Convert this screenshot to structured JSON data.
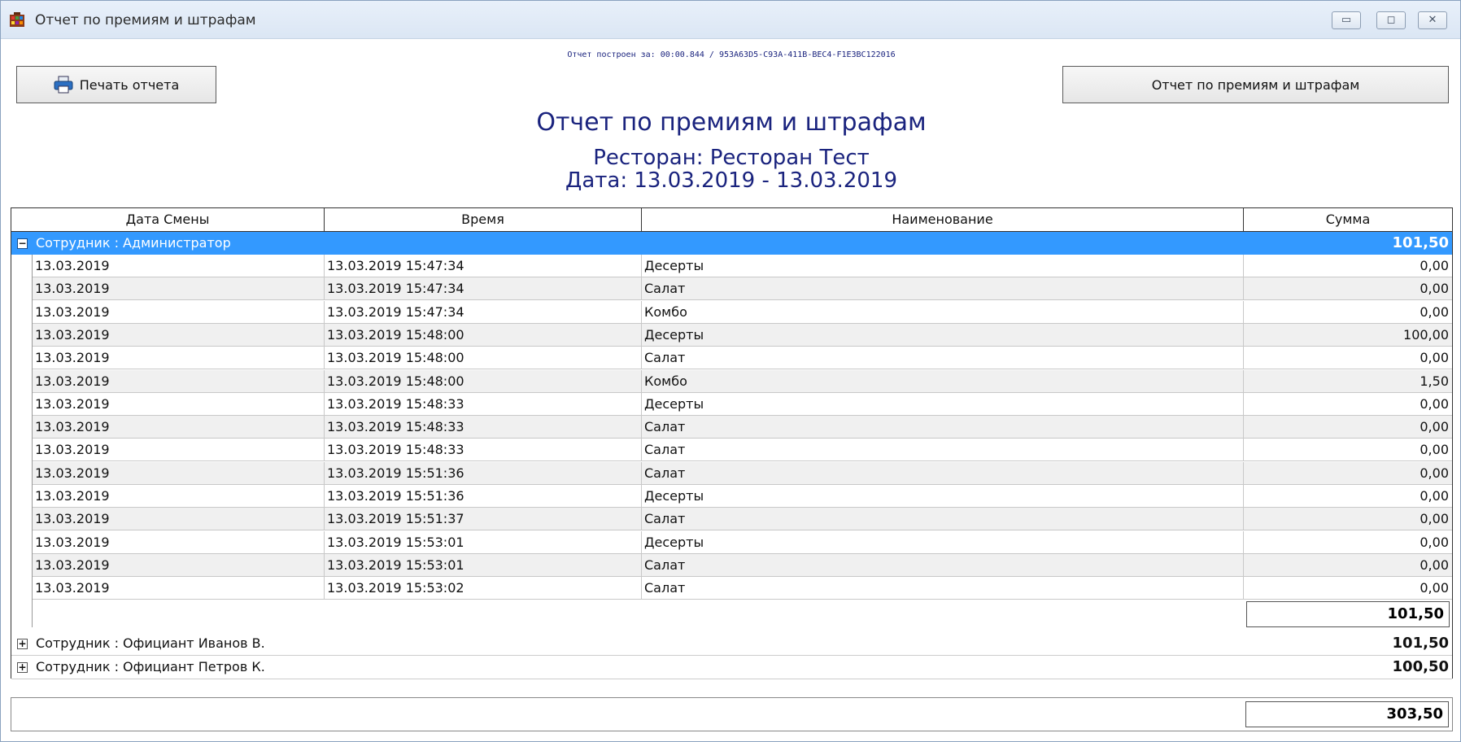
{
  "window": {
    "title": "Отчет по премиям и штрафам",
    "minimize_glyph": "▭",
    "maximize_glyph": "◻",
    "close_glyph": "✕"
  },
  "meta_line": "Отчет построен за: 00:00.844 / 953A63D5-C93A-411B-BEC4-F1E3BC122016",
  "buttons": {
    "print_label": "Печать отчета",
    "report_label": "Отчет по премиям и штрафам"
  },
  "report": {
    "title": "Отчет по премиям и штрафам",
    "restaurant": "Ресторан: Ресторан Тест",
    "date": "Дата: 13.03.2019 - 13.03.2019"
  },
  "table": {
    "columns": [
      "Дата Смены",
      "Время",
      "Наименование",
      "Сумма"
    ],
    "groups": [
      {
        "label": "Сотрудник : Администратор",
        "total": "101,50",
        "expanded": true,
        "toggle": "−",
        "rows": [
          [
            "13.03.2019",
            "13.03.2019 15:47:34",
            "Десерты",
            "0,00"
          ],
          [
            "13.03.2019",
            "13.03.2019 15:47:34",
            "Салат",
            "0,00"
          ],
          [
            "13.03.2019",
            "13.03.2019 15:47:34",
            "Комбо",
            "0,00"
          ],
          [
            "13.03.2019",
            "13.03.2019 15:48:00",
            "Десерты",
            "100,00"
          ],
          [
            "13.03.2019",
            "13.03.2019 15:48:00",
            "Салат",
            "0,00"
          ],
          [
            "13.03.2019",
            "13.03.2019 15:48:00",
            "Комбо",
            "1,50"
          ],
          [
            "13.03.2019",
            "13.03.2019 15:48:33",
            "Десерты",
            "0,00"
          ],
          [
            "13.03.2019",
            "13.03.2019 15:48:33",
            "Салат",
            "0,00"
          ],
          [
            "13.03.2019",
            "13.03.2019 15:48:33",
            "Салат",
            "0,00"
          ],
          [
            "13.03.2019",
            "13.03.2019 15:51:36",
            "Салат",
            "0,00"
          ],
          [
            "13.03.2019",
            "13.03.2019 15:51:36",
            "Десерты",
            "0,00"
          ],
          [
            "13.03.2019",
            "13.03.2019 15:51:37",
            "Салат",
            "0,00"
          ],
          [
            "13.03.2019",
            "13.03.2019 15:53:01",
            "Десерты",
            "0,00"
          ],
          [
            "13.03.2019",
            "13.03.2019 15:53:01",
            "Салат",
            "0,00"
          ],
          [
            "13.03.2019",
            "13.03.2019 15:53:02",
            "Салат",
            "0,00"
          ]
        ],
        "subtotal": "101,50"
      },
      {
        "label": "Сотрудник : Официант Иванов В.",
        "total": "101,50",
        "expanded": false,
        "toggle": "+"
      },
      {
        "label": "Сотрудник : Официант Петров К.",
        "total": "100,50",
        "expanded": false,
        "toggle": "+"
      }
    ],
    "grand_total": "303,50"
  }
}
